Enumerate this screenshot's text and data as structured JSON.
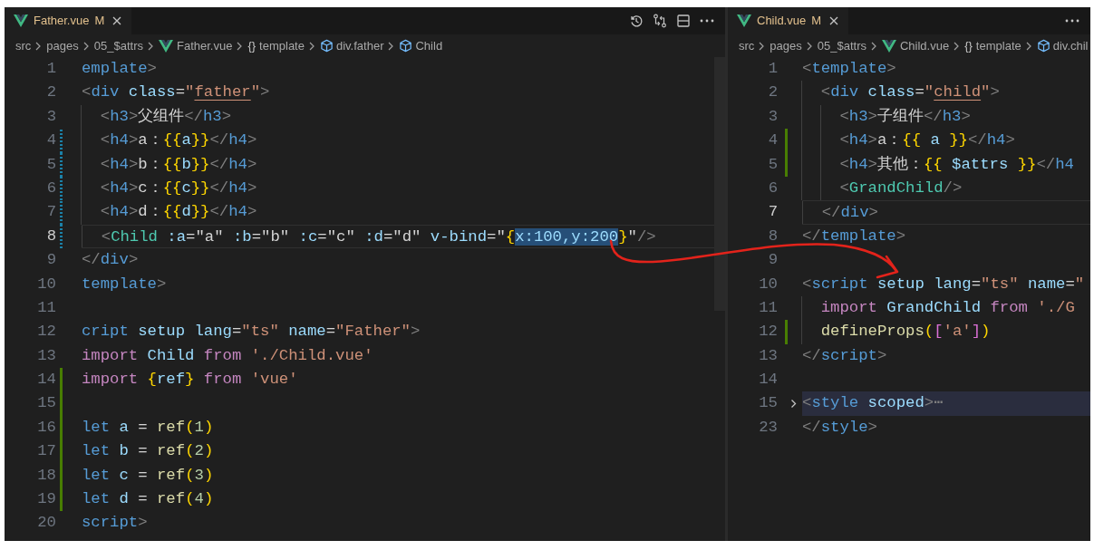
{
  "panes": [
    {
      "show_actions": true,
      "tab": {
        "label": "Father.vue",
        "badge": "M"
      },
      "breadcrumbs": [
        {
          "kind": "text",
          "label": "src"
        },
        {
          "kind": "text",
          "label": "pages"
        },
        {
          "kind": "text",
          "label": "05_$attrs"
        },
        {
          "kind": "vue",
          "label": "Father.vue"
        },
        {
          "kind": "braces",
          "glyph": "{}",
          "label": "template"
        },
        {
          "kind": "element",
          "label": "div.father"
        },
        {
          "kind": "element",
          "label": "Child"
        }
      ],
      "lines": [
        {
          "number": "1",
          "tokens": [
            {
              "text": "emplate",
              "kind": "tag"
            },
            {
              "text": ">",
              "kind": "punct"
            }
          ]
        },
        {
          "number": "2",
          "tokens": [
            {
              "text": "<",
              "kind": "punct"
            },
            {
              "text": "div",
              "kind": "tag"
            },
            {
              "text": " class",
              "kind": "attr"
            },
            {
              "text": "=",
              "kind": "text"
            },
            {
              "text": "\"",
              "kind": "str"
            },
            {
              "text": "father",
              "kind": "stru"
            },
            {
              "text": "\"",
              "kind": "str"
            },
            {
              "text": ">",
              "kind": "punct"
            }
          ]
        },
        {
          "number": "3",
          "tokens": [
            {
              "text": "  <",
              "kind": "punct"
            },
            {
              "text": "h3",
              "kind": "tag"
            },
            {
              "text": ">",
              "kind": "punct"
            },
            {
              "text": "父组件",
              "kind": "text"
            },
            {
              "text": "</",
              "kind": "punct"
            },
            {
              "text": "h3",
              "kind": "tag"
            },
            {
              "text": ">",
              "kind": "punct"
            }
          ]
        },
        {
          "number": "4",
          "modified": true,
          "tokens": [
            {
              "text": "  <",
              "kind": "punct"
            },
            {
              "text": "h4",
              "kind": "tag"
            },
            {
              "text": ">",
              "kind": "punct"
            },
            {
              "text": "a：",
              "kind": "text"
            },
            {
              "text": "{{",
              "kind": "brace"
            },
            {
              "text": "a",
              "kind": "var"
            },
            {
              "text": "}}",
              "kind": "brace"
            },
            {
              "text": "</",
              "kind": "punct"
            },
            {
              "text": "h4",
              "kind": "tag"
            },
            {
              "text": ">",
              "kind": "punct"
            }
          ]
        },
        {
          "number": "5",
          "modified": true,
          "tokens": [
            {
              "text": "  <",
              "kind": "punct"
            },
            {
              "text": "h4",
              "kind": "tag"
            },
            {
              "text": ">",
              "kind": "punct"
            },
            {
              "text": "b：",
              "kind": "text"
            },
            {
              "text": "{{",
              "kind": "brace"
            },
            {
              "text": "b",
              "kind": "var"
            },
            {
              "text": "}}",
              "kind": "brace"
            },
            {
              "text": "</",
              "kind": "punct"
            },
            {
              "text": "h4",
              "kind": "tag"
            },
            {
              "text": ">",
              "kind": "punct"
            }
          ]
        },
        {
          "number": "6",
          "modified": true,
          "tokens": [
            {
              "text": "  <",
              "kind": "punct"
            },
            {
              "text": "h4",
              "kind": "tag"
            },
            {
              "text": ">",
              "kind": "punct"
            },
            {
              "text": "c：",
              "kind": "text"
            },
            {
              "text": "{{",
              "kind": "brace"
            },
            {
              "text": "c",
              "kind": "var"
            },
            {
              "text": "}}",
              "kind": "brace"
            },
            {
              "text": "</",
              "kind": "punct"
            },
            {
              "text": "h4",
              "kind": "tag"
            },
            {
              "text": ">",
              "kind": "punct"
            }
          ]
        },
        {
          "number": "7",
          "modified": true,
          "tokens": [
            {
              "text": "  <",
              "kind": "punct"
            },
            {
              "text": "h4",
              "kind": "tag"
            },
            {
              "text": ">",
              "kind": "punct"
            },
            {
              "text": "d：",
              "kind": "text"
            },
            {
              "text": "{{",
              "kind": "brace"
            },
            {
              "text": "d",
              "kind": "var"
            },
            {
              "text": "}}",
              "kind": "brace"
            },
            {
              "text": "</",
              "kind": "punct"
            },
            {
              "text": "h4",
              "kind": "tag"
            },
            {
              "text": ">",
              "kind": "punct"
            }
          ]
        },
        {
          "number": "8",
          "modified": true,
          "current": true,
          "tokens": [
            {
              "text": "  <",
              "kind": "punct"
            },
            {
              "text": "Child",
              "kind": "comp"
            },
            {
              "text": " :a",
              "kind": "attr"
            },
            {
              "text": "=\"a\"",
              "kind": "text"
            },
            {
              "text": " :b",
              "kind": "attr"
            },
            {
              "text": "=\"b\"",
              "kind": "text"
            },
            {
              "text": " :c",
              "kind": "attr"
            },
            {
              "text": "=\"c\"",
              "kind": "text"
            },
            {
              "text": " :d",
              "kind": "attr"
            },
            {
              "text": "=\"d\"",
              "kind": "text"
            },
            {
              "text": " v-bind",
              "kind": "attr"
            },
            {
              "text": "=\"",
              "kind": "text"
            },
            {
              "text": "{",
              "kind": "brace"
            },
            {
              "text": "x:100,y:200",
              "kind": "sel"
            },
            {
              "text": "}",
              "kind": "brace"
            },
            {
              "text": "\"",
              "kind": "text"
            },
            {
              "text": "/>",
              "kind": "punct"
            }
          ]
        },
        {
          "number": "9",
          "tokens": [
            {
              "text": "</",
              "kind": "punct"
            },
            {
              "text": "div",
              "kind": "tag"
            },
            {
              "text": ">",
              "kind": "punct"
            }
          ]
        },
        {
          "number": "10",
          "tokens": [
            {
              "text": "template",
              "kind": "tag"
            },
            {
              "text": ">",
              "kind": "punct"
            }
          ]
        },
        {
          "number": "11"
        },
        {
          "number": "12",
          "tokens": [
            {
              "text": "cript",
              "kind": "tag"
            },
            {
              "text": " setup lang",
              "kind": "attr"
            },
            {
              "text": "=",
              "kind": "text"
            },
            {
              "text": "\"ts\"",
              "kind": "str"
            },
            {
              "text": " name",
              "kind": "attr"
            },
            {
              "text": "=",
              "kind": "text"
            },
            {
              "text": "\"Father\"",
              "kind": "str"
            },
            {
              "text": ">",
              "kind": "punct"
            }
          ]
        },
        {
          "number": "13",
          "tokens": [
            {
              "text": "import",
              "kind": "kw"
            },
            {
              "text": " Child",
              "kind": "var"
            },
            {
              "text": " from",
              "kind": "kw"
            },
            {
              "text": " './Child.vue'",
              "kind": "str"
            }
          ]
        },
        {
          "number": "14",
          "added": true,
          "tokens": [
            {
              "text": "import",
              "kind": "kw"
            },
            {
              "text": " {",
              "kind": "brace"
            },
            {
              "text": "ref",
              "kind": "var"
            },
            {
              "text": "}",
              "kind": "brace"
            },
            {
              "text": " from",
              "kind": "kw"
            },
            {
              "text": " 'vue'",
              "kind": "str"
            }
          ]
        },
        {
          "number": "15",
          "added": true
        },
        {
          "number": "16",
          "added": true,
          "tokens": [
            {
              "text": "let",
              "kind": "storage"
            },
            {
              "text": " a",
              "kind": "var"
            },
            {
              "text": " = ",
              "kind": "text"
            },
            {
              "text": "ref",
              "kind": "fn"
            },
            {
              "text": "(",
              "kind": "brace"
            },
            {
              "text": "1",
              "kind": "num"
            },
            {
              "text": ")",
              "kind": "brace"
            }
          ]
        },
        {
          "number": "17",
          "added": true,
          "tokens": [
            {
              "text": "let",
              "kind": "storage"
            },
            {
              "text": " b",
              "kind": "var"
            },
            {
              "text": " = ",
              "kind": "text"
            },
            {
              "text": "ref",
              "kind": "fn"
            },
            {
              "text": "(",
              "kind": "brace"
            },
            {
              "text": "2",
              "kind": "num"
            },
            {
              "text": ")",
              "kind": "brace"
            }
          ]
        },
        {
          "number": "18",
          "added": true,
          "tokens": [
            {
              "text": "let",
              "kind": "storage"
            },
            {
              "text": " c",
              "kind": "var"
            },
            {
              "text": " = ",
              "kind": "text"
            },
            {
              "text": "ref",
              "kind": "fn"
            },
            {
              "text": "(",
              "kind": "brace"
            },
            {
              "text": "3",
              "kind": "num"
            },
            {
              "text": ")",
              "kind": "brace"
            }
          ]
        },
        {
          "number": "19",
          "added": true,
          "tokens": [
            {
              "text": "let",
              "kind": "storage"
            },
            {
              "text": " d",
              "kind": "var"
            },
            {
              "text": " = ",
              "kind": "text"
            },
            {
              "text": "ref",
              "kind": "fn"
            },
            {
              "text": "(",
              "kind": "brace"
            },
            {
              "text": "4",
              "kind": "num"
            },
            {
              "text": ")",
              "kind": "brace"
            }
          ]
        },
        {
          "number": "20",
          "tokens": [
            {
              "text": "script",
              "kind": "tag"
            },
            {
              "text": ">",
              "kind": "punct"
            }
          ]
        }
      ]
    },
    {
      "show_actions": false,
      "tab": {
        "label": "Child.vue",
        "badge": "M"
      },
      "breadcrumbs": [
        {
          "kind": "text",
          "label": "src"
        },
        {
          "kind": "text",
          "label": "pages"
        },
        {
          "kind": "text",
          "label": "05_$attrs"
        },
        {
          "kind": "vue",
          "label": "Child.vue"
        },
        {
          "kind": "braces",
          "glyph": "{}",
          "label": "template"
        },
        {
          "kind": "element",
          "label": "div.chil"
        }
      ],
      "lines": [
        {
          "number": "1",
          "tokens": [
            {
              "text": "<",
              "kind": "punct"
            },
            {
              "text": "template",
              "kind": "tag"
            },
            {
              "text": ">",
              "kind": "punct"
            }
          ]
        },
        {
          "number": "2",
          "tokens": [
            {
              "text": "  <",
              "kind": "punct"
            },
            {
              "text": "div",
              "kind": "tag"
            },
            {
              "text": " class",
              "kind": "attr"
            },
            {
              "text": "=",
              "kind": "text"
            },
            {
              "text": "\"",
              "kind": "str"
            },
            {
              "text": "child",
              "kind": "stru"
            },
            {
              "text": "\"",
              "kind": "str"
            },
            {
              "text": ">",
              "kind": "punct"
            }
          ]
        },
        {
          "number": "3",
          "tokens": [
            {
              "text": "    <",
              "kind": "punct"
            },
            {
              "text": "h3",
              "kind": "tag"
            },
            {
              "text": ">",
              "kind": "punct"
            },
            {
              "text": "子组件",
              "kind": "text"
            },
            {
              "text": "</",
              "kind": "punct"
            },
            {
              "text": "h3",
              "kind": "tag"
            },
            {
              "text": ">",
              "kind": "punct"
            }
          ]
        },
        {
          "number": "4",
          "added": true,
          "tokens": [
            {
              "text": "    <",
              "kind": "punct"
            },
            {
              "text": "h4",
              "kind": "tag"
            },
            {
              "text": ">",
              "kind": "punct"
            },
            {
              "text": "a：",
              "kind": "text"
            },
            {
              "text": "{{",
              "kind": "brace"
            },
            {
              "text": " a ",
              "kind": "var"
            },
            {
              "text": "}}",
              "kind": "brace"
            },
            {
              "text": "</",
              "kind": "punct"
            },
            {
              "text": "h4",
              "kind": "tag"
            },
            {
              "text": ">",
              "kind": "punct"
            }
          ]
        },
        {
          "number": "5",
          "added": true,
          "tokens": [
            {
              "text": "    <",
              "kind": "punct"
            },
            {
              "text": "h4",
              "kind": "tag"
            },
            {
              "text": ">",
              "kind": "punct"
            },
            {
              "text": "其他：",
              "kind": "text"
            },
            {
              "text": "{{",
              "kind": "brace"
            },
            {
              "text": " $attrs ",
              "kind": "var"
            },
            {
              "text": "}}",
              "kind": "brace"
            },
            {
              "text": "</",
              "kind": "punct"
            },
            {
              "text": "h4",
              "kind": "tag"
            }
          ]
        },
        {
          "number": "6",
          "tokens": [
            {
              "text": "    <",
              "kind": "punct"
            },
            {
              "text": "GrandChild",
              "kind": "comp"
            },
            {
              "text": "/>",
              "kind": "punct"
            }
          ]
        },
        {
          "number": "7",
          "current": true,
          "tokens": [
            {
              "text": "  </",
              "kind": "punct"
            },
            {
              "text": "div",
              "kind": "tag"
            },
            {
              "text": ">",
              "kind": "punct"
            }
          ]
        },
        {
          "number": "8",
          "tokens": [
            {
              "text": "</",
              "kind": "punct"
            },
            {
              "text": "template",
              "kind": "tag"
            },
            {
              "text": ">",
              "kind": "punct"
            }
          ]
        },
        {
          "number": "9"
        },
        {
          "number": "10",
          "tokens": [
            {
              "text": "<",
              "kind": "punct"
            },
            {
              "text": "script",
              "kind": "tag"
            },
            {
              "text": " setup lang",
              "kind": "attr"
            },
            {
              "text": "=",
              "kind": "text"
            },
            {
              "text": "\"ts\"",
              "kind": "str"
            },
            {
              "text": " name",
              "kind": "attr"
            },
            {
              "text": "=",
              "kind": "text"
            },
            {
              "text": "\"",
              "kind": "str"
            }
          ]
        },
        {
          "number": "11",
          "tokens": [
            {
              "text": "  import",
              "kind": "kw"
            },
            {
              "text": " GrandChild",
              "kind": "var"
            },
            {
              "text": " from",
              "kind": "kw"
            },
            {
              "text": " './G",
              "kind": "str"
            }
          ]
        },
        {
          "number": "12",
          "added": true,
          "tokens": [
            {
              "text": "  defineProps",
              "kind": "fn"
            },
            {
              "text": "(",
              "kind": "brace"
            },
            {
              "text": "[",
              "kind": "bracket2"
            },
            {
              "text": "'a'",
              "kind": "str"
            },
            {
              "text": "]",
              "kind": "bracket2"
            },
            {
              "text": ")",
              "kind": "brace"
            }
          ]
        },
        {
          "number": "13",
          "tokens": [
            {
              "text": "</",
              "kind": "punct"
            },
            {
              "text": "script",
              "kind": "tag"
            },
            {
              "text": ">",
              "kind": "punct"
            }
          ]
        },
        {
          "number": "14"
        },
        {
          "number": "15",
          "folded": true,
          "tokens": [
            {
              "text": "<",
              "kind": "punct"
            },
            {
              "text": "style",
              "kind": "tag"
            },
            {
              "text": " scoped",
              "kind": "attr"
            },
            {
              "text": ">",
              "kind": "punct"
            },
            {
              "text": "⋯",
              "kind": "punct"
            }
          ]
        },
        {
          "number": "23",
          "tokens": [
            {
              "text": "</",
              "kind": "punct"
            },
            {
              "text": "style",
              "kind": "tag"
            },
            {
              "text": ">",
              "kind": "punct"
            }
          ]
        }
      ]
    }
  ]
}
